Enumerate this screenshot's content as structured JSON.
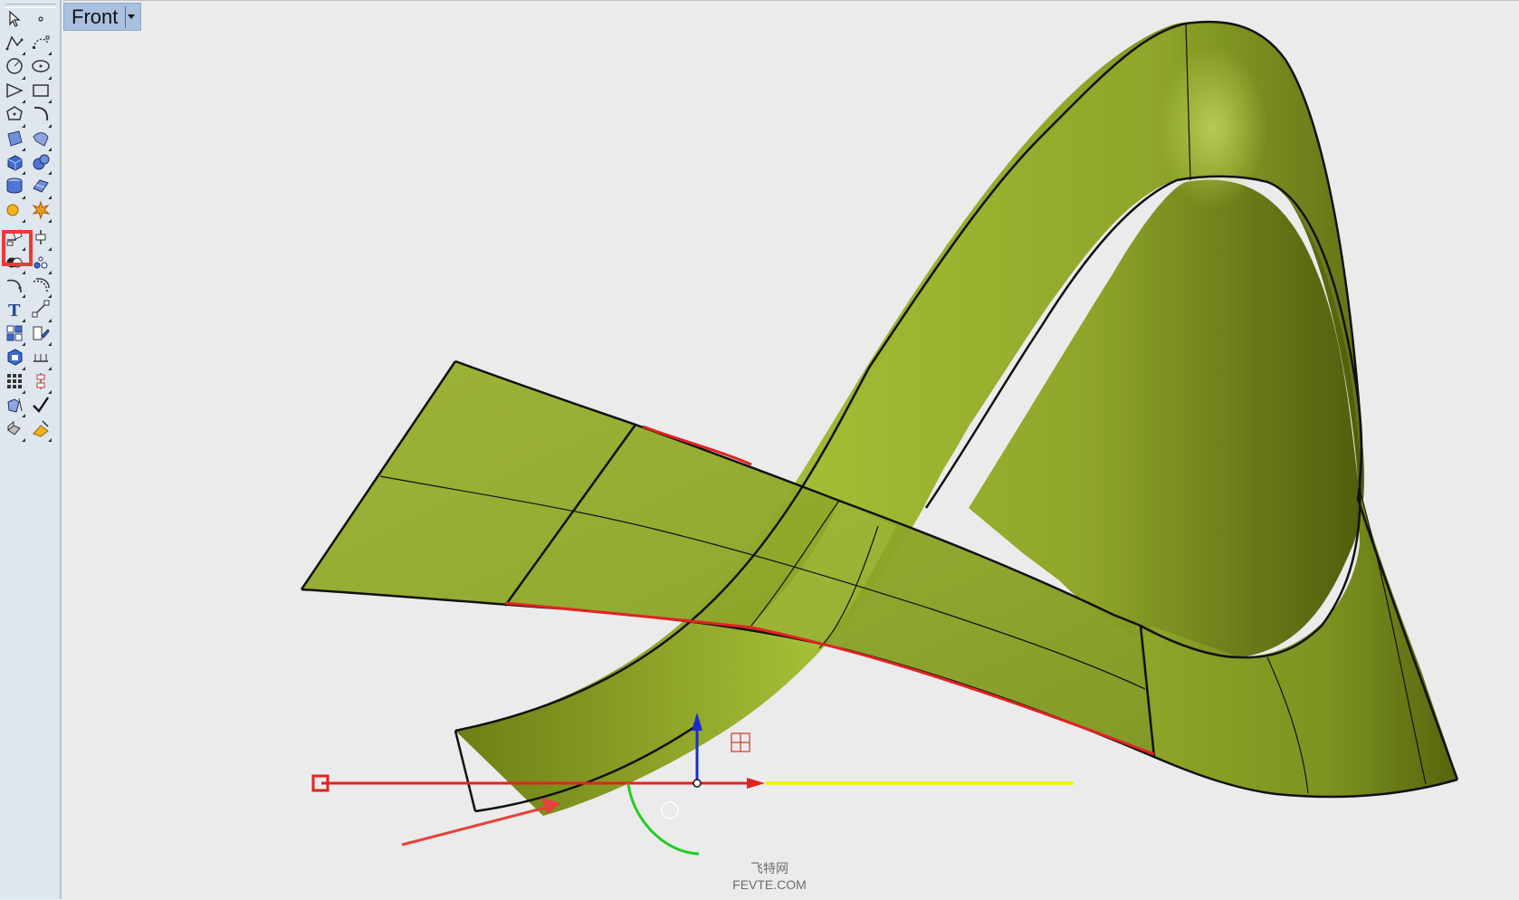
{
  "viewport": {
    "name": "Front"
  },
  "toolbar": {
    "highlighted_tool": "surface-from-curves-tool",
    "tools": [
      "select-tool",
      "point-tool",
      "polyline-tool",
      "curve-tool",
      "circle-tool",
      "ellipse-tool",
      "arc-tool",
      "rectangle-tool",
      "polygon-tool",
      "curve-from-objects-tool",
      "surface-tool",
      "surface-tools-tool",
      "box-tool",
      "sphere-tool",
      "cylinder-tool",
      "mesh-tool",
      "light-tool",
      "explode-tool",
      "surface-from-curves-tool",
      "edit-surface-tool",
      "boolean-union-tool",
      "point-object-tool",
      "fillet-tool",
      "offset-tool",
      "text-tool",
      "transform-tool",
      "group-tool",
      "render-tool",
      "solid-tool",
      "dimension-tool",
      "array-tool",
      "align-tool",
      "analyze-tool",
      "check-tool",
      "block-tool",
      "properties-tool"
    ]
  },
  "colors": {
    "surface": "#8fa92b",
    "surface_light": "#b2c84a",
    "surface_dark": "#5b6b12",
    "edge_highlight": "#e32222",
    "gumball_x": "#e32222",
    "gumball_y": "#1c9c1c",
    "gumball_z": "#1a2ccf",
    "axis_yellow": "#f2ef2a"
  },
  "watermark": {
    "line1": "飞特网",
    "line2": "FEVTE.COM"
  }
}
